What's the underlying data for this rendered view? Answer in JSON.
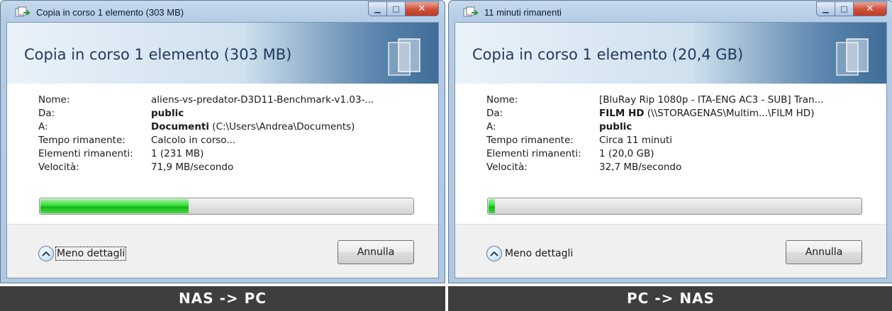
{
  "dialogs": [
    {
      "window_title": "Copia in corso 1 elemento (303 MB)",
      "header": "Copia in corso 1 elemento (303 MB)",
      "fields": [
        {
          "label": "Nome:",
          "bold": "",
          "value": "aliens-vs-predator-D3D11-Benchmark-v1.03-..."
        },
        {
          "label": "Da:",
          "bold": "public",
          "value": ""
        },
        {
          "label": "A:",
          "bold": "Documenti",
          "value": " (C:\\Users\\Andrea\\Documents)"
        },
        {
          "label": "Tempo rimanente:",
          "bold": "",
          "value": "Calcolo in corso..."
        },
        {
          "label": "Elementi rimanenti:",
          "bold": "",
          "value": "1 (231 MB)"
        },
        {
          "label": "Velocità:",
          "bold": "",
          "value": "71,9 MB/secondo"
        }
      ],
      "progress": 0.4,
      "details_toggle": "Meno dettagli",
      "details_toggle_focused": true,
      "cancel_label": "Annulla",
      "caption": "NAS -> PC"
    },
    {
      "window_title": "11 minuti rimanenti",
      "header": "Copia in corso 1 elemento (20,4 GB)",
      "fields": [
        {
          "label": "Nome:",
          "bold": "",
          "value": "[BluRay Rip 1080p - ITA-ENG AC3 - SUB] Tran..."
        },
        {
          "label": "Da:",
          "bold": "FILM HD",
          "value": " (\\\\STORAGENAS\\Multim...\\FILM HD)"
        },
        {
          "label": "A:",
          "bold": "public",
          "value": ""
        },
        {
          "label": "Tempo rimanente:",
          "bold": "",
          "value": "Circa 11 minuti"
        },
        {
          "label": "Elementi rimanenti:",
          "bold": "",
          "value": "1 (20,0 GB)"
        },
        {
          "label": "Velocità:",
          "bold": "",
          "value": "32,7 MB/secondo"
        }
      ],
      "progress": 0.02,
      "details_toggle": "Meno dettagli",
      "details_toggle_focused": false,
      "cancel_label": "Annulla",
      "caption": "PC -> NAS"
    }
  ],
  "colors": {
    "progress_green": "#22c322",
    "caption_bg": "#3e3e3e",
    "header_text": "#1e395b"
  },
  "icons": {
    "title_icon": "file-copy-icon",
    "details_toggle_icon": "chevron-up-icon",
    "header_graphic": "document-pages-icon"
  }
}
